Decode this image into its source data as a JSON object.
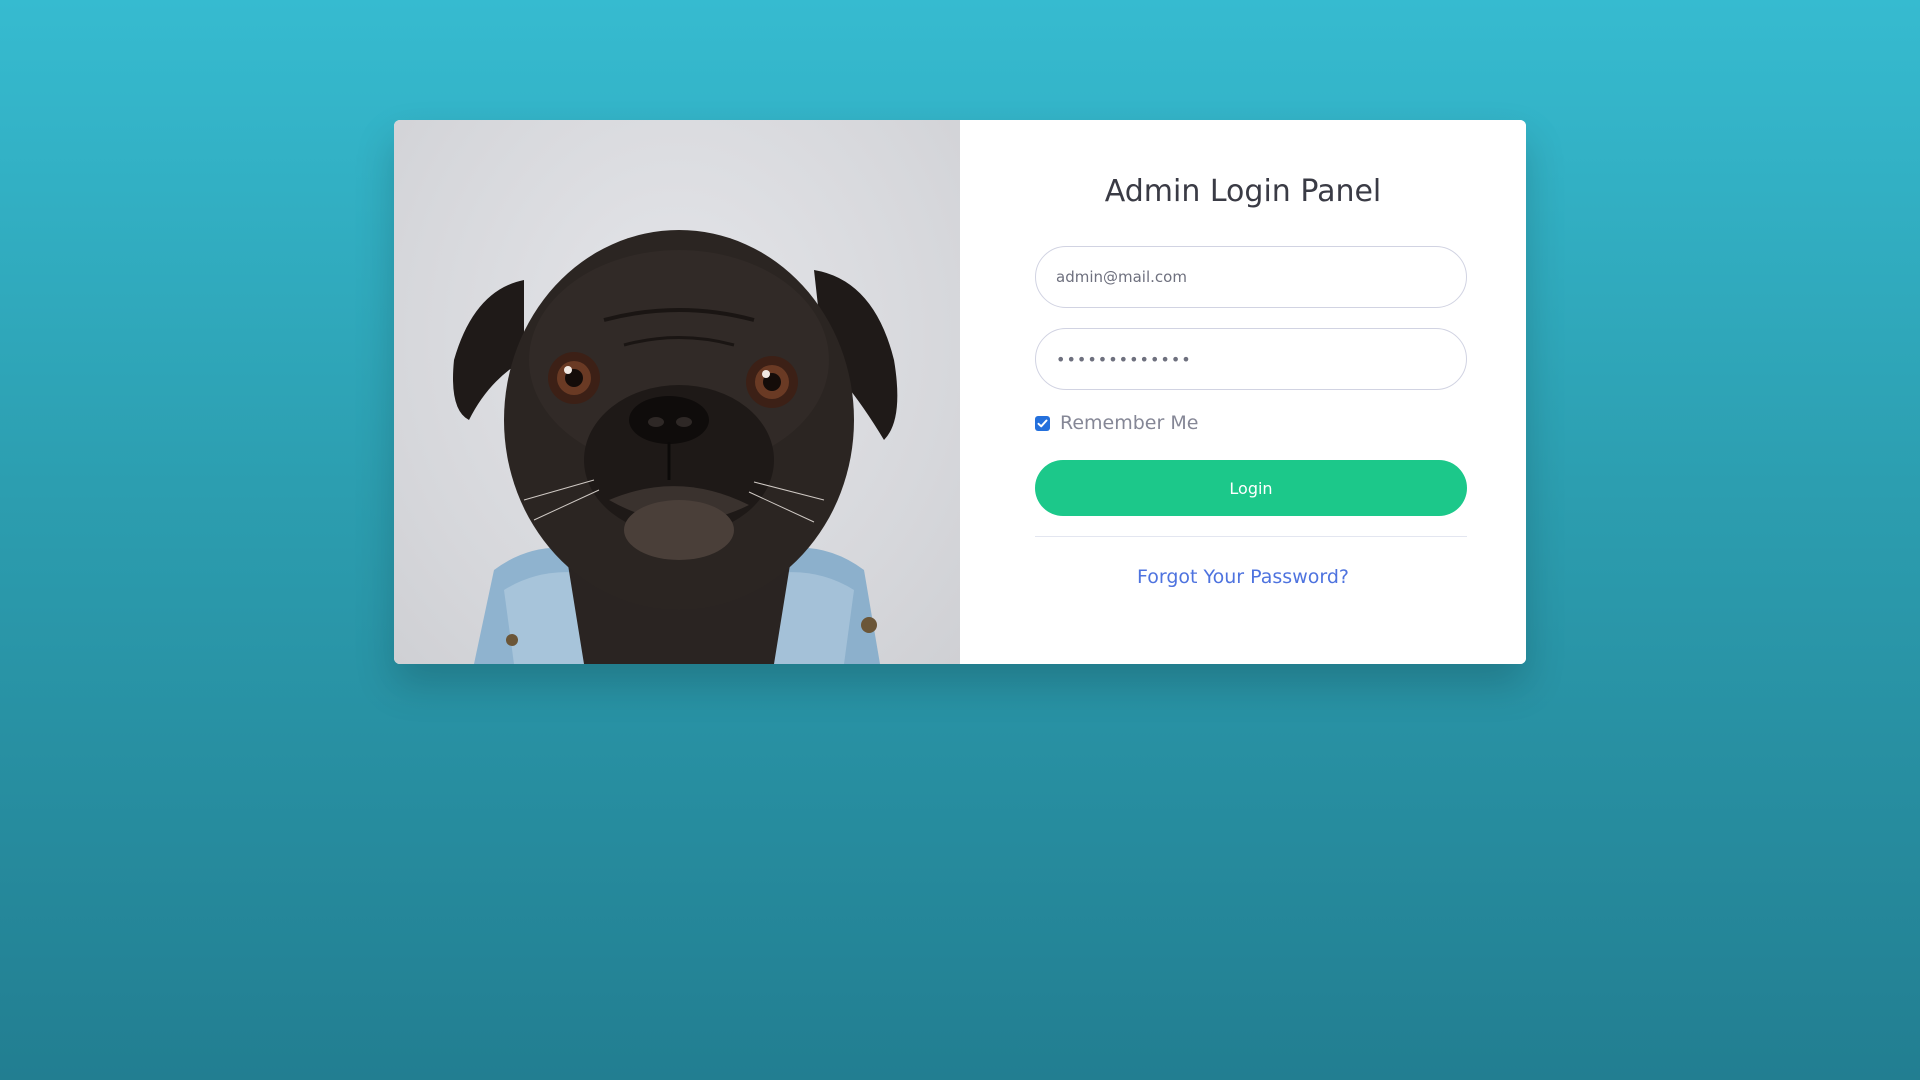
{
  "login_panel": {
    "title": "Admin Login Panel",
    "email": {
      "value": "admin@mail.com"
    },
    "password": {
      "value": "•••••••••••••"
    },
    "remember_me": {
      "label": "Remember Me",
      "checked": true
    },
    "login_button_label": "Login",
    "forgot_password_label": "Forgot Your Password?"
  },
  "photo": {
    "subject": "pug-in-denim-jacket"
  },
  "colors": {
    "background_top": "#36bbd0",
    "background_bottom": "#227e91",
    "login_button": "#1cc88a",
    "link": "#4e73df",
    "checkbox": "#2470dc",
    "title_text": "#3a3b45"
  }
}
